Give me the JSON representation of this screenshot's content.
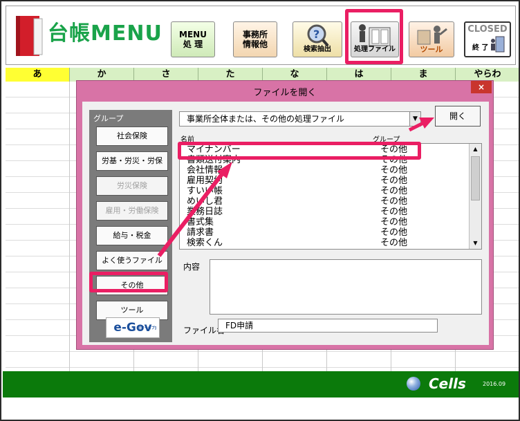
{
  "app": {
    "title": "台帳MENU",
    "toolbar": {
      "menu_label": "MENU\n処 理",
      "jimusho_label": "事務所\n情報他",
      "kensaku_label": "検索抽出",
      "shori_label": "処理ファイル",
      "tool_label": "ツール",
      "closed_label": "CLOSED",
      "closed_sub": "終 了"
    },
    "tabs": [
      "あ",
      "か",
      "さ",
      "た",
      "な",
      "は",
      "ま",
      "やらわ"
    ],
    "footer": {
      "brand": "Cells",
      "version": "2016.09"
    }
  },
  "dialog": {
    "title": "ファイルを開く",
    "close_label": "×",
    "group_label": "グループ",
    "groups": [
      {
        "label": "社会保険"
      },
      {
        "label": "労基・労災・労保"
      },
      {
        "label": "労災保険"
      },
      {
        "label": "雇用・労働保険"
      },
      {
        "label": "給与・税金"
      },
      {
        "label": "よく使うファイル"
      },
      {
        "label": "その他"
      },
      {
        "label": "ツール"
      }
    ],
    "egov_label": "e-Gov",
    "egov_sub": "[イーガブ]",
    "combo_value": "事業所全体または、その他の処理ファイル",
    "open_label": "開く",
    "list_headers": {
      "name": "名前",
      "group": "グループ"
    },
    "files": [
      {
        "name": "マイナンバー",
        "group": "その他"
      },
      {
        "name": "書類送付案内",
        "group": "その他"
      },
      {
        "name": "会社情報",
        "group": "その他"
      },
      {
        "name": "雇用契約",
        "group": "その他"
      },
      {
        "name": "すいい帳",
        "group": "その他"
      },
      {
        "name": "めいし君",
        "group": "その他"
      },
      {
        "name": "業務日誌",
        "group": "その他"
      },
      {
        "name": "書式集",
        "group": "その他"
      },
      {
        "name": "請求書",
        "group": "その他"
      },
      {
        "name": "検索くん",
        "group": "その他"
      }
    ],
    "naiyo_label": "内容",
    "filename_label": "ファイル名",
    "filename_value": "FD申請"
  },
  "colors": {
    "highlight": "#ea1e63",
    "dialog_frame": "#d873a6",
    "title_green": "#1aa34a",
    "footer_green": "#0b7a0b"
  }
}
